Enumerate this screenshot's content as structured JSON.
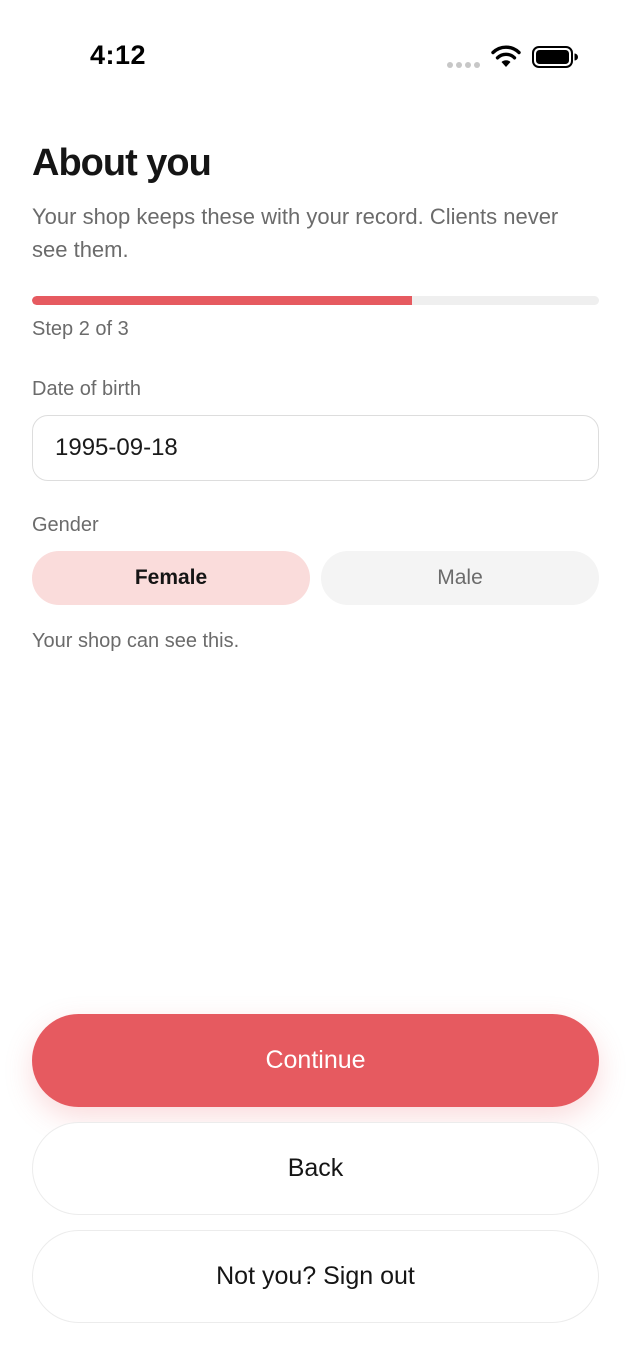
{
  "status_bar": {
    "time": "4:12",
    "icons": [
      "signal-dots-icon",
      "wifi-icon",
      "battery-icon"
    ]
  },
  "header": {
    "title": "About you",
    "subtitle": "Your shop keeps these with your record. Clients never see them."
  },
  "progress": {
    "fraction": 0.67,
    "label": "Step 2 of 3",
    "fill_color": "#e65a60",
    "track_color": "#efefef"
  },
  "form": {
    "dob": {
      "label": "Date of birth",
      "value": "1995-09-18"
    },
    "gender": {
      "label": "Gender",
      "options": [
        "Female",
        "Male"
      ],
      "selected": "Female",
      "hint": "Your shop can see this."
    }
  },
  "actions": {
    "continue_label": "Continue",
    "back_label": "Back",
    "signout_label": "Not you? Sign out"
  },
  "colors": {
    "accent": "#e65a60",
    "selected_segment_bg": "#fadcdb",
    "unselected_segment_bg": "#f4f4f4",
    "muted_text": "#6b6b6b"
  }
}
